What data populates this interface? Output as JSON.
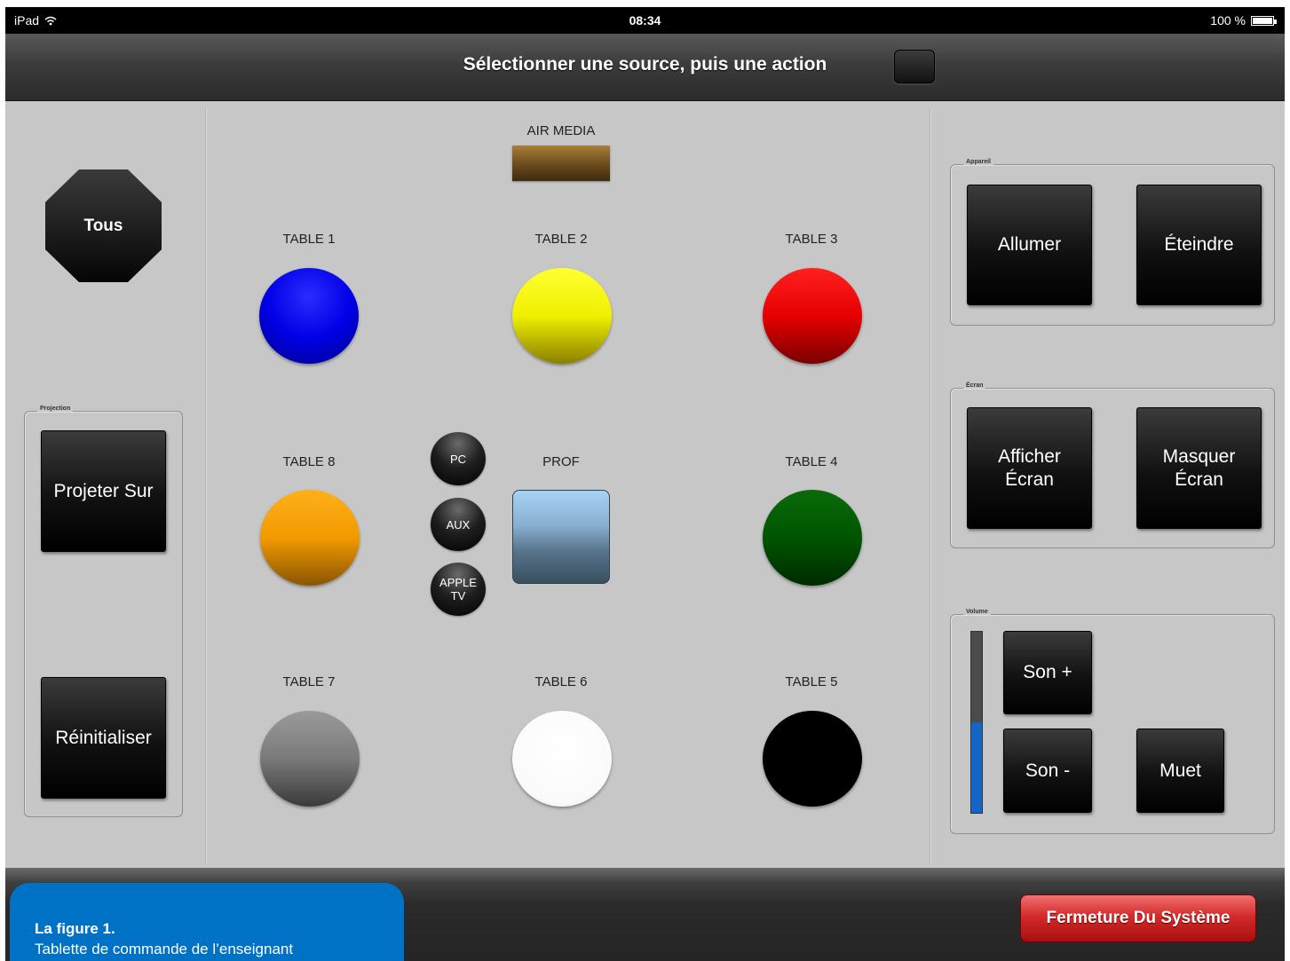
{
  "status_bar": {
    "device": "iPad",
    "wifi_icon": "wifi-icon",
    "time": "08:34",
    "battery_text": "100 %",
    "battery_level": 1.0
  },
  "header": {
    "title": "Sélectionner une source, puis une action"
  },
  "left_panel": {
    "all_button": "Tous",
    "projection_legend": "Projection",
    "project_button": "Projeter Sur",
    "reset_button": "Réinitialiser"
  },
  "sources": {
    "air_media": {
      "label": "AIR MEDIA",
      "color": "#7a5522"
    },
    "tables": [
      {
        "label": "TABLE 1",
        "color": "#0000ff"
      },
      {
        "label": "TABLE 2",
        "color": "#ffff00"
      },
      {
        "label": "TABLE 3",
        "color": "#ff0000"
      },
      {
        "label": "TABLE 8",
        "color": "#ffa500"
      },
      {
        "label": "TABLE 4",
        "color": "#006400"
      },
      {
        "label": "TABLE 7",
        "color": "#808080"
      },
      {
        "label": "TABLE 6",
        "color": "#ffffff"
      },
      {
        "label": "TABLE 5",
        "color": "#000000"
      }
    ],
    "prof": {
      "label": "PROF",
      "inputs": [
        "PC",
        "AUX",
        "APPLE\nTV"
      ]
    }
  },
  "right_panel": {
    "device_group": {
      "legend": "Appareil",
      "on": "Allumer",
      "off": "Éteindre"
    },
    "screen_group": {
      "legend": "Écran",
      "show": "Afficher\nÉcran",
      "hide": "Masquer\nÉcran"
    },
    "volume_group": {
      "legend": "Volume",
      "up": "Son +",
      "down": "Son -",
      "mute": "Muet",
      "level": 0.5
    }
  },
  "footer": {
    "shutdown_button": "Fermeture Du Système",
    "caption_title": "La figure 1.",
    "caption_text": "Tablette de commande de l’enseignant"
  }
}
